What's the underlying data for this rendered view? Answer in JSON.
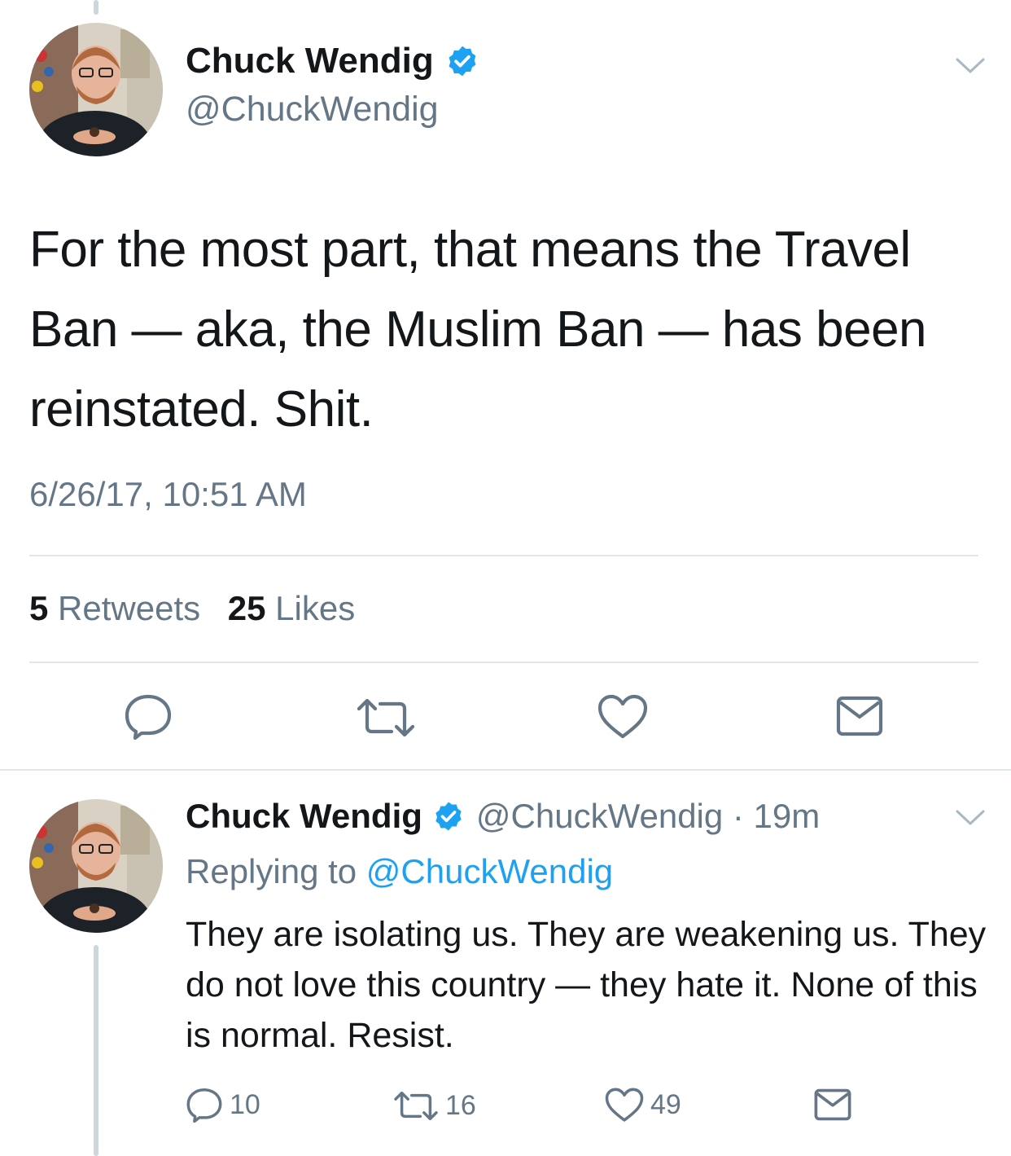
{
  "main_tweet": {
    "author_name": "Chuck Wendig",
    "handle": "@ChuckWendig",
    "text": "For the most part, that means the Travel Ban — aka, the Muslim Ban — has been reinstated. Shit.",
    "timestamp": "6/26/17, 10:51 AM",
    "retweets_count": "5",
    "retweets_label": "Retweets",
    "likes_count": "25",
    "likes_label": "Likes",
    "actions": [
      "reply-icon",
      "retweet-icon",
      "like-icon",
      "direct-message-icon"
    ]
  },
  "reply_tweet": {
    "author_name": "Chuck Wendig",
    "handle_time": "@ChuckWendig · 19m",
    "replying_prefix": "Replying to",
    "replying_to": "@ChuckWendig",
    "text": "They are isolating us. They are weakening us. They do not love this country — they hate it. None of this is normal. Resist.",
    "reply_count": "10",
    "retweet_count": "16",
    "like_count": "49"
  },
  "colors": {
    "primary_text": "#14171a",
    "secondary_text": "#657786",
    "accent": "#1da1f2",
    "icon": "#657786",
    "divider": "#e1e8ed"
  }
}
